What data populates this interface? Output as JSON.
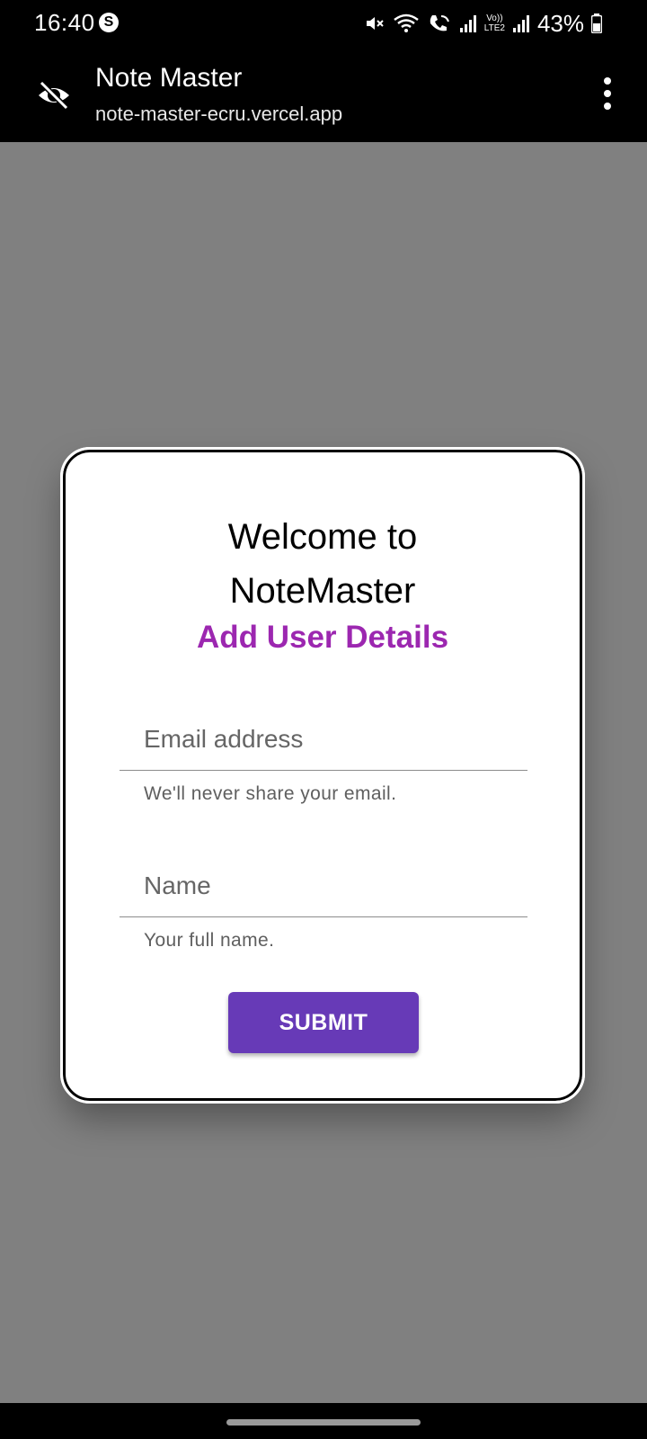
{
  "status_bar": {
    "time": "16:40",
    "app_icon": "S",
    "lte_label": "LTE2",
    "volte_label": "Vo))",
    "battery_percent": "43%",
    "icons": [
      "mute-icon",
      "wifi-icon",
      "wifi-calling-icon",
      "signal-icon",
      "signal-icon",
      "battery-icon"
    ]
  },
  "toolbar": {
    "title": "Note Master",
    "url": "note-master-ecru.vercel.app",
    "icons": [
      "incognito-eye-off-icon",
      "more-vert-icon"
    ]
  },
  "dialog": {
    "welcome_line1": "Welcome to",
    "welcome_line2": "NoteMaster",
    "subtitle": "Add User Details",
    "email_field": {
      "placeholder": "Email address",
      "value": "",
      "helper": "We'll never share your email."
    },
    "name_field": {
      "placeholder": "Name",
      "value": "",
      "helper": "Your full name."
    },
    "submit_label": "SUBMIT"
  },
  "colors": {
    "accent_purple": "#9c27b0",
    "button_purple": "#673ab7",
    "backdrop": "#808080"
  }
}
